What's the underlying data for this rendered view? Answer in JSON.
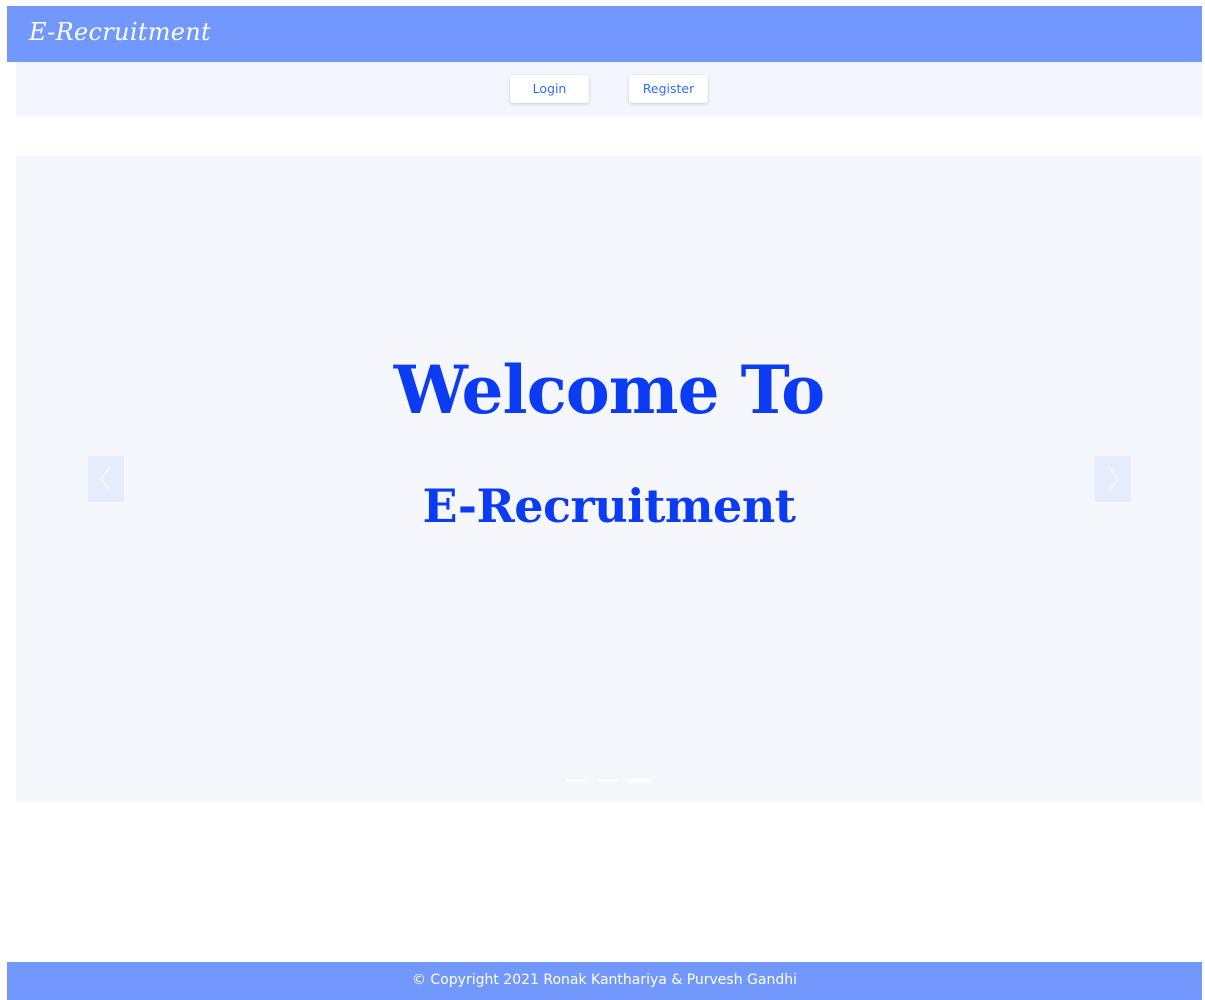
{
  "header": {
    "brand": "E-Recruitment"
  },
  "nav": {
    "login_label": "Login",
    "register_label": "Register"
  },
  "carousel": {
    "heading": "Welcome To",
    "subheading": "E-Recruitment",
    "prev_icon": "chevron-left-icon",
    "next_icon": "chevron-right-icon",
    "slide_count": 3,
    "active_slide": 3
  },
  "footer": {
    "copyright": "© Copyright 2021 Ronak Kanthariya & Purvesh Gandhi"
  },
  "colors": {
    "brand_bar": "#7298fe",
    "nav_bg": "#f3f6ff",
    "carousel_bg": "#f6f7fd",
    "heading_text": "#0b3cf4",
    "button_text": "#2e6ff0"
  }
}
